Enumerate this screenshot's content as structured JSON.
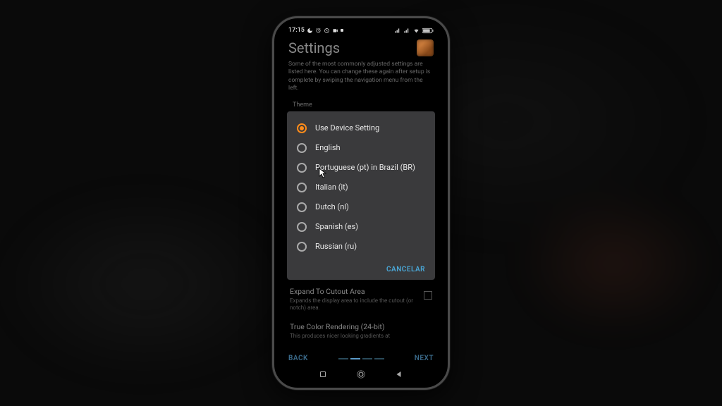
{
  "statusbar": {
    "time": "17:15",
    "icons_left": "moon alarm video",
    "icons_right": "signal wifi battery"
  },
  "header": {
    "title": "Settings",
    "subtitle": "Some of the most commonly adjusted settings are listed here. You can change these again after setup is complete by swiping the navigation menu from the left."
  },
  "section_label": "Theme",
  "dialog": {
    "options": [
      {
        "label": "Use Device Setting",
        "selected": true
      },
      {
        "label": "English",
        "selected": false
      },
      {
        "label": "Portuguese (pt) in Brazil (BR)",
        "selected": false
      },
      {
        "label": "Italian (it)",
        "selected": false
      },
      {
        "label": "Dutch (nl)",
        "selected": false
      },
      {
        "label": "Spanish (es)",
        "selected": false
      },
      {
        "label": "Russian (ru)",
        "selected": false
      }
    ],
    "cancel": "CANCELAR"
  },
  "settings": {
    "expand": {
      "title": "Expand To Cutout Area",
      "desc": "Expands the display area to include the cutout (or notch) area."
    },
    "truecolor": {
      "title": "True Color Rendering (24-bit)",
      "desc": "This produces nicer looking gradients at"
    }
  },
  "nav": {
    "back": "BACK",
    "next": "NEXT"
  }
}
